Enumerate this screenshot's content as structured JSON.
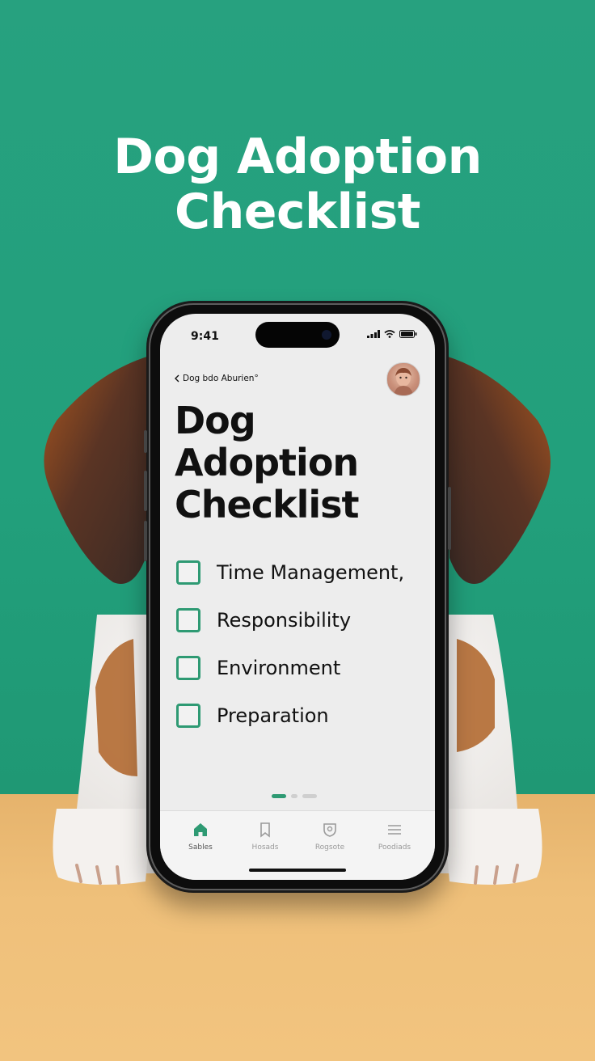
{
  "hero": {
    "title_line1": "Dog Adoption",
    "title_line2": "Checklist"
  },
  "status_bar": {
    "time": "9:41"
  },
  "nav": {
    "back_label": "Dog bdo Aburien°"
  },
  "screen": {
    "title_line1": "Dog",
    "title_line2": "Adoption",
    "title_line3": "Checklist"
  },
  "checklist": [
    {
      "label": "Time Management,",
      "checked": false
    },
    {
      "label": "Responsibility",
      "checked": false
    },
    {
      "label": "Environment",
      "checked": false
    },
    {
      "label": "Preparation",
      "checked": false
    }
  ],
  "pager": {
    "pages": 3,
    "current": 1
  },
  "tabs": [
    {
      "label": "Sables",
      "icon": "home-icon",
      "active": true
    },
    {
      "label": "Hosads",
      "icon": "bookmark-icon",
      "active": false
    },
    {
      "label": "Rogsote",
      "icon": "shield-icon",
      "active": false
    },
    {
      "label": "Poodiads",
      "icon": "menu-icon",
      "active": false
    }
  ],
  "colors": {
    "background_green": "#25A07C",
    "table": "#F2C47F",
    "accent": "#2E9A73",
    "screen_bg": "#EDEDED"
  }
}
